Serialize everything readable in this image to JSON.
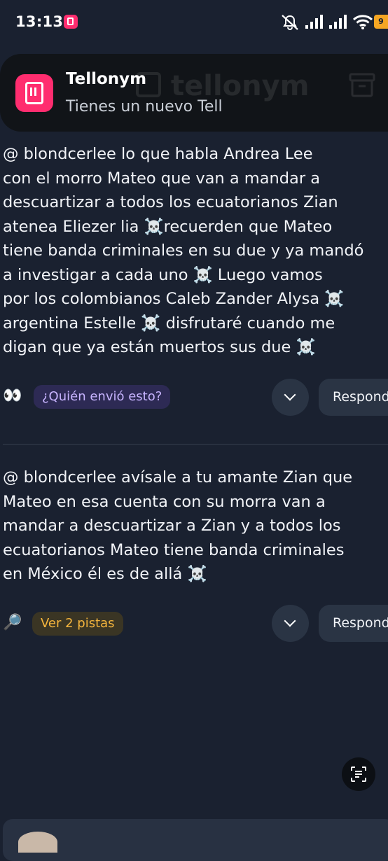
{
  "status_bar": {
    "time": "13:13",
    "battery": "9"
  },
  "notification": {
    "app": "Tellonym",
    "message": "Tienes un nuevo Tell",
    "background_logo": "tellonym"
  },
  "tells": [
    {
      "lines": [
        "@  blondcerlee lo que habla Andrea Lee",
        "con el morro Mateo que van a mandar a",
        "descuartizar a todos los ecuatorianos Zian",
        "atenea Eliezer lia ☠️recuerden que Mateo",
        "tiene banda criminales en su due y ya mandó",
        "a investigar a cada uno ☠️ Luego vamos",
        "por los colombianos Caleb Zander Alysa ☠️",
        "argentina Estelle ☠️ disfrutaré cuando me",
        "digan que ya están muertos sus due ☠️"
      ],
      "hint_emoji": "👀",
      "hint_label": "¿Quién envió esto?",
      "reply_label": "Responder"
    },
    {
      "lines": [
        "@  blondcerlee avísale a tu amante Zian que",
        "Mateo en esa cuenta con su morra van a",
        "mandar a descuartizar a Zian y a todos los",
        "ecuatorianos Mateo tiene banda criminales",
        "en México él es de allá ☠️"
      ],
      "hint_emoji": "🔎",
      "hint_label": "Ver 2 pistas",
      "reply_label": "Responder"
    }
  ],
  "colors": {
    "background": "#1a2130",
    "accent_pink": "#ff2d6f",
    "hint_purple": "#c7b4ff",
    "hint_orange": "#f5b53d"
  },
  "icons": [
    "notification-app-icon",
    "mute-icon",
    "signal-icon",
    "wifi-icon",
    "battery-icon",
    "chevron-down-icon",
    "text-scan-icon",
    "archive-icon"
  ]
}
